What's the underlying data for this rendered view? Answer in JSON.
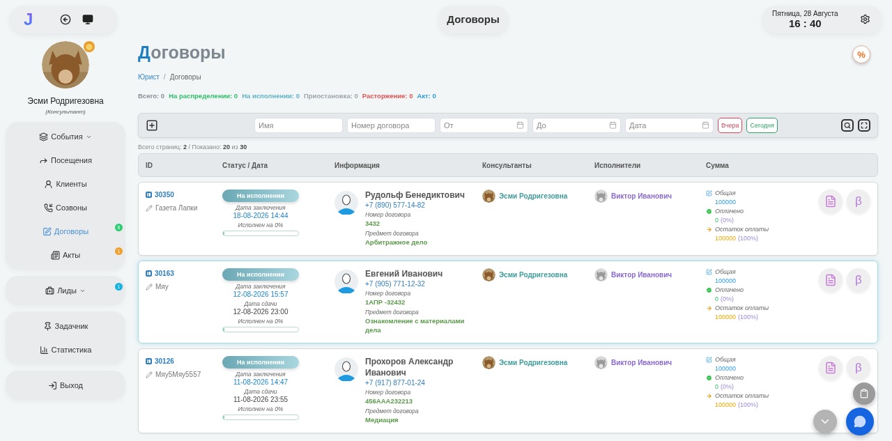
{
  "topbar": {
    "logo": "J",
    "title": "Договоры",
    "date": "Пятница, 28 Августа",
    "time": "16 : 40"
  },
  "profile": {
    "name": "Эсми Родригезовна",
    "role": "(Консультант)"
  },
  "nav_groups": [
    {
      "items": [
        {
          "label": "События",
          "has_menu": true,
          "selected": false
        },
        {
          "label": "Посещения",
          "has_menu": false,
          "selected": false
        },
        {
          "label": "Клиенты",
          "has_menu": false,
          "selected": false
        },
        {
          "label": "Созвоны",
          "has_menu": false,
          "selected": false
        },
        {
          "label": "Договоры",
          "has_menu": false,
          "selected": true,
          "badge": {
            "count": "6",
            "color": "#2ecc71"
          }
        },
        {
          "label": "Акты",
          "has_menu": false,
          "selected": false,
          "badge": {
            "count": "1",
            "color": "#f0a030"
          }
        }
      ]
    },
    {
      "items": [
        {
          "label": "Лиды",
          "has_menu": true,
          "selected": false,
          "badge": {
            "count": "1",
            "color": "#17b3e0"
          }
        }
      ]
    },
    {
      "items": [
        {
          "label": "Задачник",
          "has_menu": false,
          "selected": false
        },
        {
          "label": "Статистика",
          "has_menu": false,
          "selected": false
        }
      ]
    },
    {
      "items": [
        {
          "label": "Выход",
          "has_menu": false,
          "selected": false
        }
      ]
    }
  ],
  "page": {
    "title": "Договоры",
    "breadcrumbs": [
      "Юрист",
      "Договоры"
    ],
    "separator": "/",
    "discount": "%"
  },
  "stats": [
    {
      "text": "Всего: 0",
      "color": "#888e94"
    },
    {
      "text": "На распределении: 0",
      "color": "#2fbf6a"
    },
    {
      "text": "На исполнении: 0",
      "color": "#5fb3c6"
    },
    {
      "text": "Приостановка: 0",
      "color": "#9ea5ab"
    },
    {
      "text": "Расторжение: 0",
      "color": "#e05353"
    },
    {
      "text": "Акт: 0",
      "color": "#2d9ae0"
    }
  ],
  "filters": {
    "fields": [
      {
        "placeholder": "Имя",
        "kind": "text"
      },
      {
        "placeholder": "Номер договора",
        "kind": "text"
      },
      {
        "placeholder": "От",
        "kind": "date"
      },
      {
        "placeholder": "До",
        "kind": "date"
      },
      {
        "placeholder": "Дата",
        "kind": "date"
      }
    ],
    "quick": [
      {
        "label": "Вчера",
        "color": "#d0455a"
      },
      {
        "label": "Сегодня",
        "color": "#2f9e6a"
      }
    ]
  },
  "summary": "Всего страниц: **2** / Показано: **20** из **30**",
  "table": {
    "columns": [
      "ID",
      "Статус / Дата",
      "Информация",
      "Консультанты",
      "Исполнители",
      "Сумма"
    ],
    "rows": [
      {
        "id": "30350",
        "note": "Газета Лапки",
        "selected": false,
        "status": "На исполнении",
        "dates": [
          {
            "label": "Дата заключения",
            "value": "18-08-2026 14:44",
            "kind": "signed"
          }
        ],
        "progress": {
          "label": "Исполнен на 0%",
          "level": 0.02
        },
        "client": {
          "name": "Рудольф Бенедиктович",
          "phone": "+7 (890) 577-14-82"
        },
        "fields": [
          {
            "label": "Номер договора",
            "value": "3432"
          },
          {
            "label": "Предмет договора",
            "value": "Арбитражное дело"
          }
        ],
        "consultant": "Эсми Родригезовна",
        "executor": "Виктор Иванович",
        "sum": {
          "total_label": "Общая",
          "total": "100000",
          "paid_label": "Оплачено",
          "paid": "0",
          "paid_share": "(0%)",
          "rest_label": "Остаток оплаты",
          "rest": "100000",
          "rest_share": "(100%)"
        },
        "beta": "β"
      },
      {
        "id": "30163",
        "note": "Мяу",
        "selected": true,
        "status": "На исполнении",
        "dates": [
          {
            "label": "Дата заключения",
            "value": "12-08-2026 15:57",
            "kind": "signed"
          },
          {
            "label": "Дата сдачи",
            "value": "12-08-2026 23:00",
            "kind": "due"
          }
        ],
        "progress": {
          "label": "Исполнен на 0%",
          "level": 0.02
        },
        "client": {
          "name": "Евгений Иванович",
          "phone": "+7 (905) 771-12-32"
        },
        "fields": [
          {
            "label": "Номер договора",
            "value": "1АПР -32432"
          },
          {
            "label": "Предмет договора",
            "value": "Ознакомление с материалами дела"
          }
        ],
        "consultant": "Эсми Родригезовна",
        "executor": "Виктор Иванович",
        "sum": {
          "total_label": "Общая",
          "total": "100000",
          "paid_label": "Оплачено",
          "paid": "0",
          "paid_share": "(0%)",
          "rest_label": "Остаток оплаты",
          "rest": "100000",
          "rest_share": "(100%)"
        },
        "beta": "β"
      },
      {
        "id": "30126",
        "note": "Мяу5Мяу5557",
        "selected": false,
        "status": "На исполнении",
        "dates": [
          {
            "label": "Дата заключения",
            "value": "11-08-2026 14:47",
            "kind": "signed"
          },
          {
            "label": "Дата сдачи",
            "value": "11-08-2026 23:55",
            "kind": "due"
          }
        ],
        "progress": {
          "label": "Исполнен на 0%",
          "level": 0.02
        },
        "client": {
          "name": "Прохоров Александр Иванович",
          "phone": "+7 (917) 877-01-24"
        },
        "fields": [
          {
            "label": "Номер договора",
            "value": "456AAA232213"
          },
          {
            "label": "Предмет договора",
            "value": "Медиация"
          }
        ],
        "consultant": "Эсми Родригезовна",
        "executor": "Виктор Иванович",
        "sum": {
          "total_label": "Общая",
          "total": "100000",
          "paid_label": "Оплачено",
          "paid": "0",
          "paid_share": "(0%)",
          "rest_label": "Остаток оплаты",
          "rest": "100000",
          "rest_share": "(100%)"
        },
        "beta": "β"
      }
    ]
  }
}
